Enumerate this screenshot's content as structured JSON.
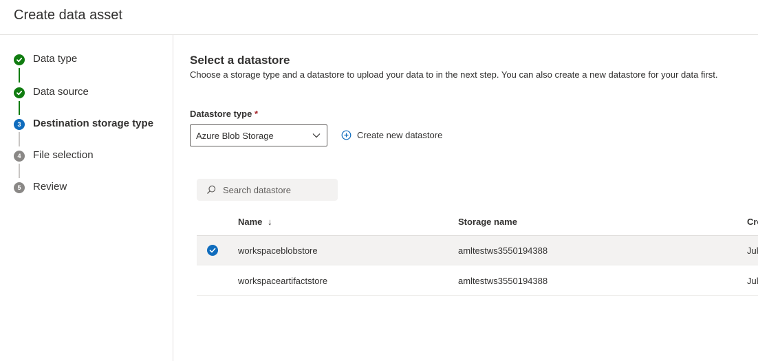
{
  "header": {
    "title": "Create data asset"
  },
  "steps": [
    {
      "number": "",
      "label": "Data type",
      "state": "done"
    },
    {
      "number": "",
      "label": "Data source",
      "state": "done"
    },
    {
      "number": "3",
      "label": "Destination storage type",
      "state": "current"
    },
    {
      "number": "4",
      "label": "File selection",
      "state": "pending"
    },
    {
      "number": "5",
      "label": "Review",
      "state": "pending"
    }
  ],
  "main": {
    "title": "Select a datastore",
    "description": "Choose a storage type and a datastore to upload your data to in the next step. You can also create a new datastore for your data first.",
    "datastore_type_label": "Datastore type",
    "required_mark": "*",
    "datastore_type_value": "Azure Blob Storage",
    "create_new_label": "Create new datastore",
    "search_placeholder": "Search datastore"
  },
  "table": {
    "columns": {
      "name": "Name",
      "sort_arrow": "↓",
      "storage": "Storage name",
      "created": "Cre"
    },
    "rows": [
      {
        "name": "workspaceblobstore",
        "storage": "amltestws3550194388",
        "created": "Jul",
        "selected": true
      },
      {
        "name": "workspaceartifactstore",
        "storage": "amltestws3550194388",
        "created": "Jul",
        "selected": false
      }
    ]
  },
  "colors": {
    "done": "#107c10",
    "current": "#0f6cbd",
    "pending": "#8a8886",
    "required": "#a4262c"
  }
}
